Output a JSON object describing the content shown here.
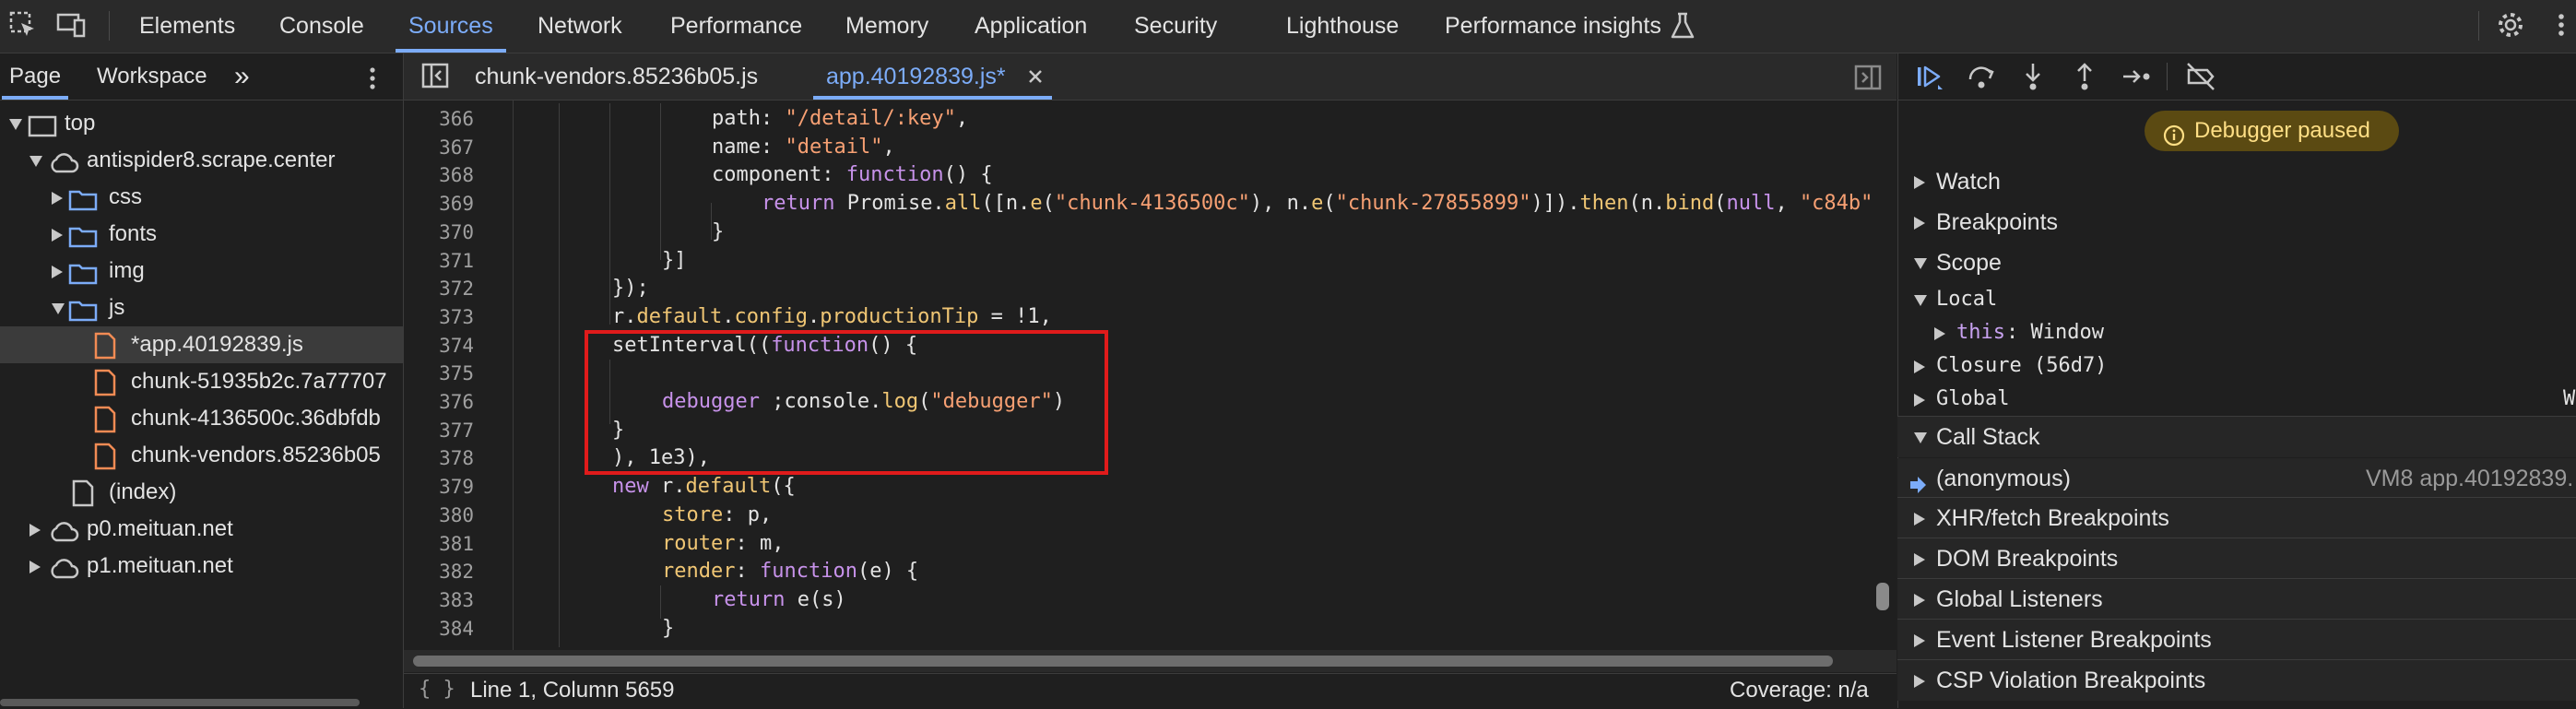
{
  "toolbar": {
    "tabs": [
      "Elements",
      "Console",
      "Sources",
      "Network",
      "Performance",
      "Memory",
      "Application",
      "Security",
      "Lighthouse",
      "Performance insights"
    ],
    "active_tab": "Sources"
  },
  "navigator": {
    "tabs": [
      "Page",
      "Workspace"
    ],
    "active_tab": "Page",
    "tree": [
      {
        "label": "top"
      },
      {
        "label": "antispider8.scrape.center"
      },
      {
        "label": "css"
      },
      {
        "label": "fonts"
      },
      {
        "label": "img"
      },
      {
        "label": "js"
      },
      {
        "label": "*app.40192839.js"
      },
      {
        "label": "chunk-51935b2c.7a77707"
      },
      {
        "label": "chunk-4136500c.36dbfdb"
      },
      {
        "label": "chunk-vendors.85236b05"
      },
      {
        "label": "(index)"
      },
      {
        "label": "p0.meituan.net"
      },
      {
        "label": "p1.meituan.net"
      }
    ]
  },
  "editor": {
    "tabs": [
      "chunk-vendors.85236b05.js",
      "app.40192839.js*"
    ],
    "active_tab": "app.40192839.js*",
    "line_numbers": [
      "366",
      "367",
      "368",
      "369",
      "370",
      "371",
      "372",
      "373",
      "374",
      "375",
      "376",
      "377",
      "378",
      "379",
      "380",
      "381",
      "382",
      "383",
      "384"
    ],
    "status_position": "Line 1, Column 5659",
    "status_coverage": "Coverage: n/a",
    "code": {
      "l366": [
        "path: ",
        "\"/detail/:key\"",
        ","
      ],
      "l367": [
        "name: ",
        "\"detail\"",
        ","
      ],
      "l368": [
        "component: ",
        "function",
        "() {"
      ],
      "l369": [
        "return ",
        "Promise.",
        "all",
        "([n.",
        "e",
        "(",
        "\"chunk-4136500c\"",
        "), n.",
        "e",
        "(",
        "\"chunk-27855899\"",
        ")]).",
        "then",
        "(n.",
        "bind",
        "(",
        "null",
        ", ",
        "\"c84b\""
      ],
      "l370": "}",
      "l371": "}]",
      "l372": "});",
      "l373": [
        "r.",
        "default",
        ".",
        "config",
        ".",
        "productionTip",
        " = !1,"
      ],
      "l374": [
        "setInterval((",
        "function",
        "() {"
      ],
      "l376": [
        "debugger",
        " ;console.",
        "log",
        "(",
        "\"debugger\"",
        ")"
      ],
      "l377": "}",
      "l378": "), 1e3),",
      "l379": [
        "new ",
        "r.",
        "default",
        "({"
      ],
      "l380": [
        "store",
        ": p,"
      ],
      "l381": [
        "router",
        ": m,"
      ],
      "l382": [
        "render",
        ": ",
        "function",
        "(e) {"
      ],
      "l383": [
        "return ",
        "e(s)"
      ],
      "l384": "}"
    }
  },
  "debugger": {
    "paused_label": "Debugger paused",
    "sections": {
      "watch": "Watch",
      "breakpoints": "Breakpoints",
      "scope": "Scope",
      "local": "Local",
      "this_key": "this",
      "this_val": ": Window",
      "closure": "Closure (56d7)",
      "global": "Global",
      "global_val": "W",
      "call_stack": "Call Stack",
      "frame_name": "(anonymous)",
      "frame_loc": "VM8 app.40192839.",
      "xhr": "XHR/fetch Breakpoints",
      "dom": "DOM Breakpoints",
      "global_listeners": "Global Listeners",
      "event_listener": "Event Listener Breakpoints",
      "csp": "CSP Violation Breakpoints"
    }
  },
  "colors": {
    "accent": "#7cacf8",
    "highlight_box": "#e01b1b",
    "paused_bg": "#5b4a12",
    "paused_text": "#ffdf85"
  }
}
